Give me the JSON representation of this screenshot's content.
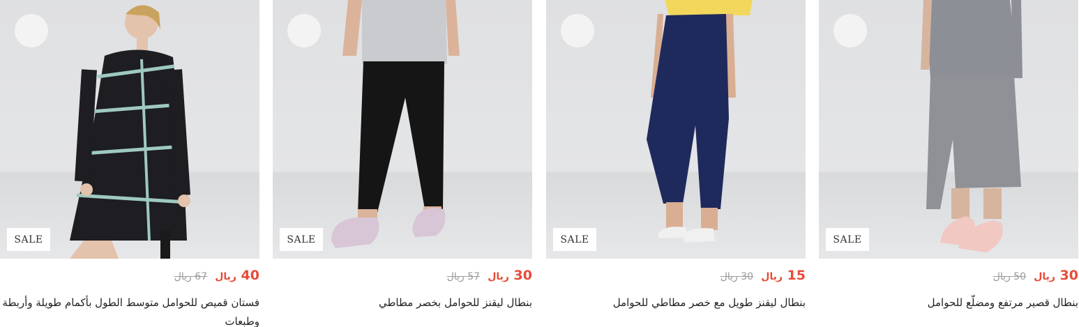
{
  "products": [
    {
      "sale_badge": "SALE",
      "price_now": "40",
      "currency": "ريال",
      "price_was": "67",
      "title": "فستان قميص للحوامل متوسط الطول بأكمام طويلة وأربطة وطبعات"
    },
    {
      "sale_badge": "SALE",
      "price_now": "30",
      "currency": "ريال",
      "price_was": "57",
      "title": "بنطال ليقنز للحوامل بخصر مطاطي"
    },
    {
      "sale_badge": "SALE",
      "price_now": "15",
      "currency": "ريال",
      "price_was": "30",
      "title": "بنطال ليقنز طويل مع خصر مطاطي للحوامل"
    },
    {
      "sale_badge": "SALE",
      "price_now": "30",
      "currency": "ريال",
      "price_was": "50",
      "title": "بنطال قصير مرتفع ومضلّع للحوامل"
    }
  ]
}
